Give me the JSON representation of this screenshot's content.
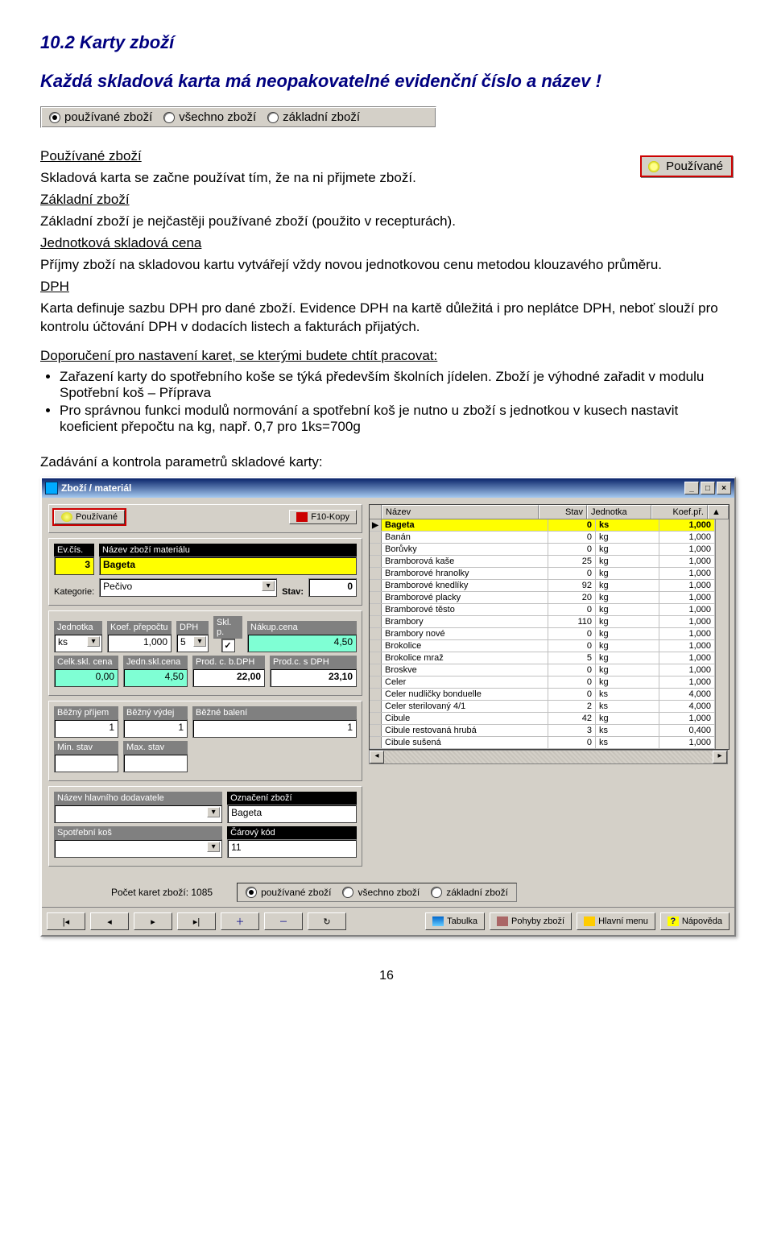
{
  "section": {
    "num_title": "10.2  Karty zboží",
    "intro": "Každá skladová karta má neopakovatelné evidenční číslo a název !"
  },
  "filter_options": {
    "opt1": "používané zboží",
    "opt2": "všechno zboží",
    "opt3": "základní zboží"
  },
  "side_button": "Používané",
  "text": {
    "p1_u": "Používané zboží",
    "p1": "Skladová karta se začne používat tím, že na ni přijmete zboží.",
    "p2_u": "Základní zboží",
    "p2": "Základní zboží je nejčastěji používané zboží (použito v recepturách).",
    "p3_u": "Jednotková skladová cena",
    "p3": "Příjmy zboží na skladovou kartu vytvářejí vždy novou jednotkovou cenu metodou klouzavého průměru.",
    "p4_u": "DPH",
    "p4": "Karta definuje sazbu DPH pro dané zboží. Evidence DPH na kartě důležitá i pro neplátce DPH, neboť slouží pro kontrolu účtování DPH v dodacích listech a fakturách přijatých.",
    "rec_u": "Doporučení pro nastavení karet, se kterými budete chtít pracovat:",
    "b1": "Zařazení karty do spotřebního koše se týká především školních jídelen. Zboží je výhodné zařadit v modulu Spotřební koš – Příprava",
    "b2": "Pro správnou funkci modulů normování a spotřební koš je nutno u zboží s jednotkou v kusech nastavit koeficient přepočtu na kg, např. 0,7 pro 1ks=700g",
    "sub": "Zadávání a kontrola parametrů skladové karty:"
  },
  "win": {
    "title": "Zboží / materiál",
    "top_btn1": "Používané",
    "top_btn2": "F10-Kopy",
    "labels": {
      "evcis": "Ev.čís.",
      "nazevzm": "Název zboží materiálu",
      "kategorie": "Kategorie:",
      "stav": "Stav:",
      "jednotka": "Jednotka",
      "koef": "Koef. přepočtu",
      "dph": "DPH",
      "sklp": "Skl. p.",
      "nakup": "Nákup.cena",
      "celk": "Celk.skl. cena",
      "jednskl": "Jedn.skl.cena",
      "prodbd": "Prod. c. b.DPH",
      "prodsd": "Prod.c. s DPH",
      "bprij": "Běžný příjem",
      "bvyd": "Běžný výdej",
      "bbal": "Běžné balení",
      "minst": "Min. stav",
      "maxst": "Max. stav",
      "dodav": "Název hlavního dodavatele",
      "oznac": "Označení zboží",
      "spkos": "Spotřební koš",
      "ckod": "Čárový kód"
    },
    "vals": {
      "evcis": "3",
      "nazev": "Bageta",
      "kategorie": "Pečivo",
      "stav": "0",
      "jednotka": "ks",
      "koef": "1,000",
      "dph": "5",
      "nakup": "4,50",
      "celk": "0,00",
      "jednskl": "4,50",
      "prodbd": "22,00",
      "prodsd": "23,10",
      "bprij": "1",
      "bvyd": "1",
      "bbal": "1",
      "dodav": "",
      "oznac": "Bageta",
      "spkos": "",
      "ckod": "11"
    },
    "thead": {
      "c1": "Název",
      "c2": "Stav",
      "c3": "Jednotka",
      "c4": "Koef.př."
    },
    "rows": [
      {
        "n": "Bageta",
        "s": "0",
        "j": "ks",
        "k": "1,000",
        "sel": true
      },
      {
        "n": "Banán",
        "s": "0",
        "j": "kg",
        "k": "1,000"
      },
      {
        "n": "Borůvky",
        "s": "0",
        "j": "kg",
        "k": "1,000"
      },
      {
        "n": "Bramborová kaše",
        "s": "25",
        "j": "kg",
        "k": "1,000"
      },
      {
        "n": "Bramborové hranolky",
        "s": "0",
        "j": "kg",
        "k": "1,000"
      },
      {
        "n": "Bramborové knedlíky",
        "s": "92",
        "j": "kg",
        "k": "1,000"
      },
      {
        "n": "Bramborové placky",
        "s": "20",
        "j": "kg",
        "k": "1,000"
      },
      {
        "n": "Bramborové těsto",
        "s": "0",
        "j": "kg",
        "k": "1,000"
      },
      {
        "n": "Brambory",
        "s": "110",
        "j": "kg",
        "k": "1,000"
      },
      {
        "n": "Brambory nové",
        "s": "0",
        "j": "kg",
        "k": "1,000"
      },
      {
        "n": "Brokolice",
        "s": "0",
        "j": "kg",
        "k": "1,000"
      },
      {
        "n": "Brokolice mraž",
        "s": "5",
        "j": "kg",
        "k": "1,000"
      },
      {
        "n": "Broskve",
        "s": "0",
        "j": "kg",
        "k": "1,000"
      },
      {
        "n": "Celer",
        "s": "0",
        "j": "kg",
        "k": "1,000"
      },
      {
        "n": "Celer nudličky bonduelle",
        "s": "0",
        "j": "ks",
        "k": "4,000"
      },
      {
        "n": "Celer sterilovaný 4/1",
        "s": "2",
        "j": "ks",
        "k": "4,000"
      },
      {
        "n": "Cibule",
        "s": "42",
        "j": "kg",
        "k": "1,000"
      },
      {
        "n": "Cibule restovaná hrubá",
        "s": "3",
        "j": "ks",
        "k": "0,400"
      },
      {
        "n": "Cibule sušená",
        "s": "0",
        "j": "ks",
        "k": "1,000"
      }
    ],
    "count": "Počet karet zboží: 1085",
    "toolbar": {
      "tabulka": "Tabulka",
      "pohyby": "Pohyby zboží",
      "hlavni": "Hlavní menu",
      "napoveda": "Nápověda"
    }
  },
  "page_num": "16"
}
